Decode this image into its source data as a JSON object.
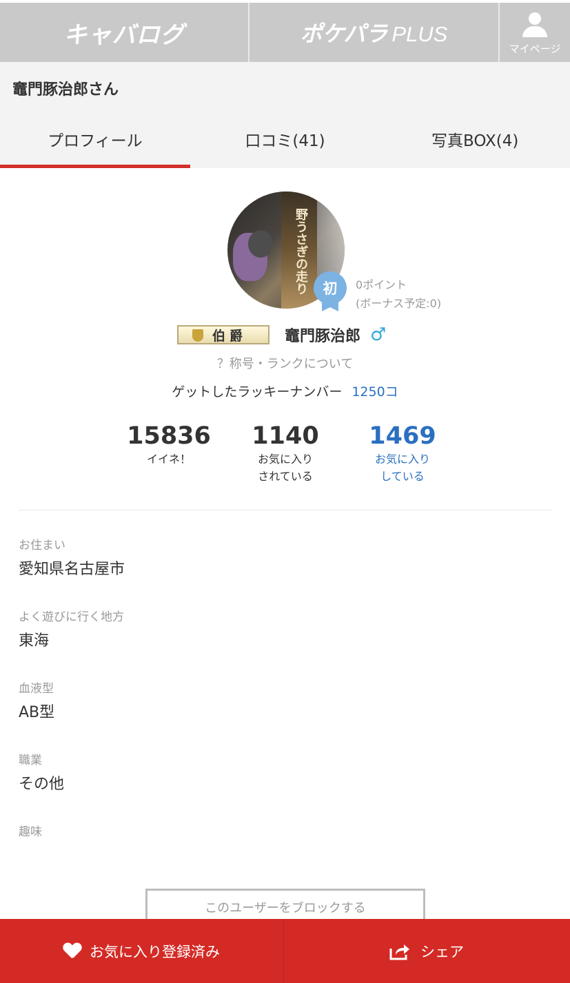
{
  "topnav": {
    "logo_left": "キャバログ",
    "logo_right_main": "ポケパラ",
    "logo_right_sub": "PLUS",
    "mypage_label": "マイページ"
  },
  "user": {
    "header_name": "竈門豚治郎さん",
    "tabs": [
      {
        "label": "プロフィール",
        "active": true
      },
      {
        "label": "口コミ(41)",
        "active": false
      },
      {
        "label": "写真BOX(4)",
        "active": false
      }
    ]
  },
  "profile": {
    "avatar_text": "野うさぎの走り",
    "first_badge": "初",
    "points": "0ポイント",
    "bonus": "(ボーナス予定:0)",
    "rank_title": "伯爵",
    "name": "竈門豚治郎",
    "gender_symbol": "♂",
    "rank_link": "？称号・ランクについて",
    "lucky_label": "ゲットしたラッキーナンバー",
    "lucky_count": "1250コ",
    "stats": [
      {
        "value": "15836",
        "label1": "イイネ！",
        "label2": ""
      },
      {
        "value": "1140",
        "label1": "お気に入り",
        "label2": "されている"
      },
      {
        "value": "1469",
        "label1": "お気に入り",
        "label2": "している"
      }
    ],
    "fields": [
      {
        "label": "お住まい",
        "value": "愛知県名古屋市"
      },
      {
        "label": "よく遊びに行く地方",
        "value": "東海"
      },
      {
        "label": "血液型",
        "value": "AB型"
      },
      {
        "label": "職業",
        "value": "その他"
      },
      {
        "label": "趣味",
        "value": ""
      }
    ],
    "block_button": "このユーザーをブロックする"
  },
  "bottombar": {
    "favorite_label": "お気に入り登録済み",
    "share_label": "シェア"
  },
  "colors": {
    "accent_red": "#d32a25",
    "link_blue": "#2a6fc0",
    "nav_gray": "#c9c9c9"
  }
}
